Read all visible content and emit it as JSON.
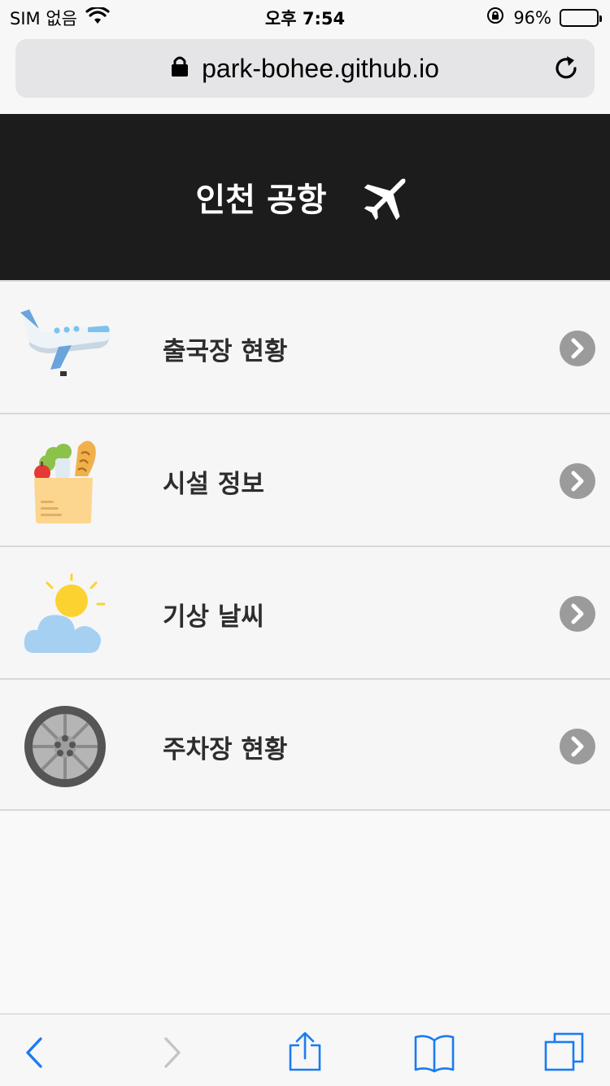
{
  "status_bar": {
    "carrier": "SIM 없음",
    "time": "오후 7:54",
    "battery_percent": "96%"
  },
  "browser": {
    "url": "park-bohee.github.io",
    "lock_icon": "lock-icon",
    "reload_icon": "reload-icon"
  },
  "header": {
    "title": "인천 공항",
    "icon": "airplane-icon",
    "background": "#1c1c1c"
  },
  "menu": {
    "items": [
      {
        "label": "출국장 현황",
        "icon": "departing-plane-icon"
      },
      {
        "label": "시설 정보",
        "icon": "grocery-bag-icon"
      },
      {
        "label": "기상 날씨",
        "icon": "sun-cloud-icon"
      },
      {
        "label": "주차장 현황",
        "icon": "car-wheel-icon"
      }
    ]
  },
  "toolbar": {
    "items": [
      "back-icon",
      "forward-icon",
      "share-icon",
      "bookmarks-icon",
      "tabs-icon"
    ],
    "accent": "#1a7cf0"
  }
}
